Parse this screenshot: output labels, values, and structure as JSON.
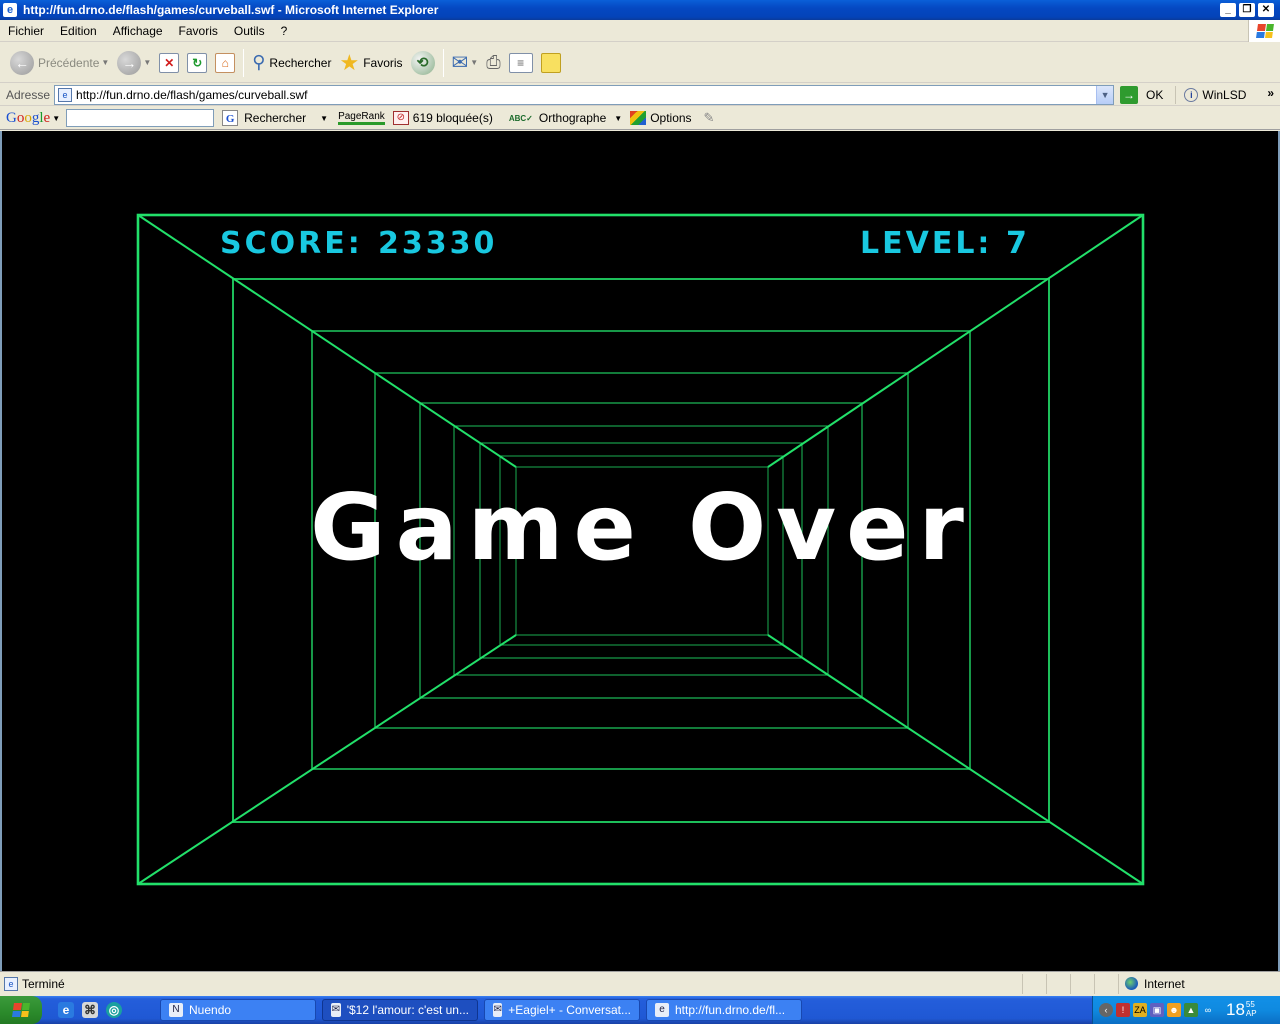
{
  "window": {
    "title": "http://fun.drno.de/flash/games/curveball.swf - Microsoft Internet Explorer",
    "app_icon": "ie-icon"
  },
  "menu": [
    "Fichier",
    "Edition",
    "Affichage",
    "Favoris",
    "Outils",
    "?"
  ],
  "toolbar": {
    "back_label": "Précédente",
    "search_label": "Rechercher",
    "favorites_label": "Favoris"
  },
  "address": {
    "label": "Adresse",
    "url": "http://fun.drno.de/flash/games/curveball.swf",
    "go_label": "OK",
    "link_label": "WinLSD"
  },
  "googlebar": {
    "search_value": "",
    "search_label": "Rechercher",
    "pagerank_label": "PageRank",
    "blocked_label": "619 bloquée(s)",
    "spell_label": "Orthographe",
    "options_label": "Options"
  },
  "game": {
    "score_label": "SCORE:",
    "score": "23330",
    "level_label": "LEVEL:",
    "level": "7",
    "message": "Game Over",
    "tunnel_color": "#22e06a",
    "hud_color": "#19c8e0"
  },
  "status": {
    "text": "Terminé",
    "zone": "Internet"
  },
  "taskbar": {
    "tasks": [
      {
        "label": "Nuendo",
        "active": false
      },
      {
        "label": "'$12 l'amour: c'est un...",
        "active": true
      },
      {
        "label": "+Eagiel+ - Conversat...",
        "active": false
      },
      {
        "label": "http://fun.drno.de/fl...",
        "active": false
      }
    ],
    "clock_hour": "18",
    "clock_min": "55",
    "clock_ampm": "AP"
  }
}
